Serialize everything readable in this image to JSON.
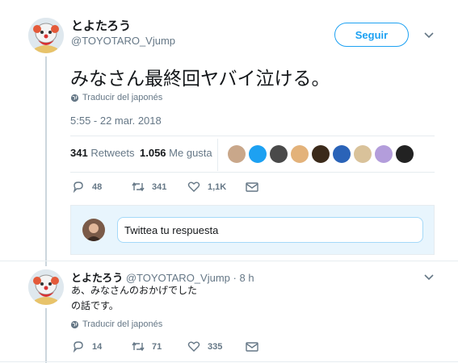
{
  "tweet": {
    "display_name": "とよたろう",
    "handle": "@TOYOTARO_Vjump",
    "follow_label": "Seguir",
    "text": "みなさん最終回ヤバイ泣ける。",
    "translate_label": "Traducir del japonés",
    "timestamp": "5:55 - 22 mar. 2018",
    "retweets_count": "341",
    "retweets_label": "Retweets",
    "likes_count": "1.056",
    "likes_label": "Me gusta",
    "actions": {
      "replies": "48",
      "retweets": "341",
      "likes": "1,1K"
    },
    "liker_colors": [
      "#c9a78a",
      "#1da1f2",
      "#4a4a4a",
      "#e3b27a",
      "#3b2a1a",
      "#2a63b8",
      "#d9c29a",
      "#b39ddb",
      "#222222"
    ]
  },
  "reply_box": {
    "placeholder": "Twittea tu respuesta"
  },
  "reply": {
    "display_name": "とよたろう",
    "handle": "@TOYOTARO_Vjump",
    "separator": "·",
    "time": "8 h",
    "text_line1": "あ、みなさんのおかげでした",
    "text_line2": "の話です。",
    "translate_label": "Traducir del japonés",
    "actions": {
      "replies": "14",
      "retweets": "71",
      "likes": "335"
    }
  },
  "colors": {
    "accent": "#1da1f2",
    "muted": "#657786",
    "divider": "#e6ecf0"
  },
  "icons": [
    "chevron-down-icon",
    "globe-icon",
    "reply-icon",
    "retweet-icon",
    "heart-icon",
    "dm-icon"
  ]
}
